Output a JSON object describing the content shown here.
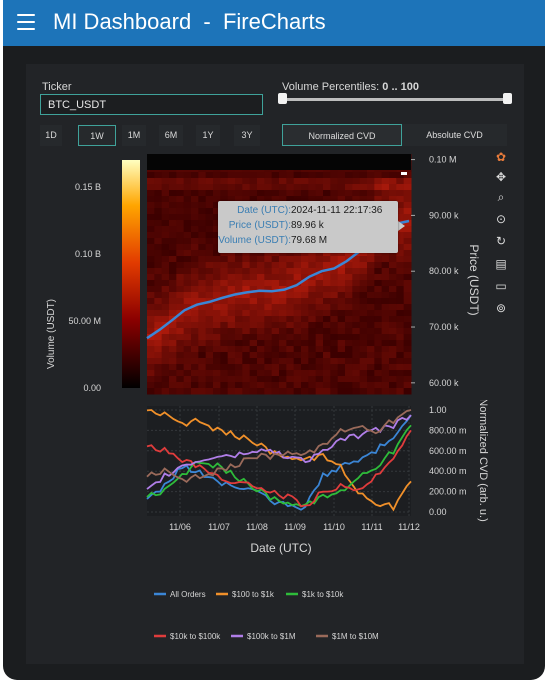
{
  "app": {
    "title": "MI Dashboard  -  FireCharts"
  },
  "controls": {
    "ticker_label": "Ticker",
    "ticker_value": "BTC_USDT",
    "percentiles_label": "Volume Percentiles:",
    "percentiles_value": "0 .. 100",
    "percentiles_range": [
      0,
      100
    ],
    "ranges": [
      "1D",
      "1W",
      "1M",
      "6M",
      "1Y",
      "3Y"
    ],
    "selected_range": "1W",
    "cvd_modes": [
      "Normalized CVD",
      "Absolute CVD"
    ],
    "selected_cvd_mode": "Normalized CVD"
  },
  "toolbar": {
    "icons": [
      "logo-icon",
      "pan-icon",
      "zoom-icon",
      "lasso-icon",
      "reset-icon",
      "save-icon",
      "comment-icon",
      "settings-icon"
    ]
  },
  "tooltip": {
    "date_label": "Date (UTC):",
    "date_value": "2024-11-11 22:17:36",
    "price_label": "Price (USDT):",
    "price_value": "89.96 k",
    "volume_label": "Volume (USDT):",
    "volume_value": "79.68 M"
  },
  "colors": {
    "topbar": "#1d74b9",
    "accent": "#3fa29a",
    "price_line": "#3b86d6"
  },
  "chart_data": [
    {
      "type": "heatmap",
      "title": "",
      "colorbar": {
        "label": "Volume (USDT)",
        "ticks": [
          "0.00",
          "50.00 M",
          "0.10 B",
          "0.15 B"
        ],
        "range": [
          0,
          170000000
        ]
      },
      "y_right": {
        "label": "Price (USDT)",
        "ticks": [
          "60.00 k",
          "70.00 k",
          "80.00 k",
          "90.00 k",
          "0.10 M"
        ],
        "range": [
          58000,
          101000
        ]
      },
      "price_series": {
        "name": "Price",
        "x": [
          "2024-11-05 12:00",
          "2024-11-06 00:00",
          "2024-11-06 06:00",
          "2024-11-06 12:00",
          "2024-11-06 18:00",
          "2024-11-07 00:00",
          "2024-11-07 12:00",
          "2024-11-08 00:00",
          "2024-11-08 12:00",
          "2024-11-09 00:00",
          "2024-11-09 12:00",
          "2024-11-10 00:00",
          "2024-11-10 06:00",
          "2024-11-10 12:00",
          "2024-11-10 18:00",
          "2024-11-11 00:00",
          "2024-11-11 06:00",
          "2024-11-11 12:00",
          "2024-11-11 18:00",
          "2024-11-11 22:17",
          "2024-11-12 00:00",
          "2024-11-12 03:00"
        ],
        "values": [
          68000,
          69500,
          71200,
          73000,
          74000,
          74500,
          75200,
          75800,
          76200,
          76500,
          76400,
          76700,
          77500,
          79000,
          80000,
          80500,
          81800,
          83500,
          86500,
          89960,
          88500,
          89000
        ]
      }
    },
    {
      "type": "line",
      "title": "",
      "xlabel": "Date (UTC)",
      "ylabel": "Normalized CVD (arb. u.)",
      "x_ticks": [
        "11/06",
        "11/07",
        "11/08",
        "11/09",
        "11/10",
        "11/11",
        "11/12"
      ],
      "y_ticks": [
        "0.00",
        "200.00 m",
        "400.00 m",
        "600.00 m",
        "800.00 m",
        "1.00"
      ],
      "ylim": [
        0,
        1
      ],
      "x": [
        "11/05 12h",
        "11/06 00h",
        "11/06 12h",
        "11/07 00h",
        "11/07 12h",
        "11/08 00h",
        "11/08 12h",
        "11/09 00h",
        "11/09 12h",
        "11/10 00h",
        "11/10 12h",
        "11/11 00h",
        "11/11 06h",
        "11/11 12h",
        "11/11 18h",
        "11/12 00h"
      ],
      "series": [
        {
          "name": "All Orders",
          "color": "#3b86d6",
          "values": [
            0.1,
            0.25,
            0.45,
            0.38,
            0.3,
            0.25,
            0.2,
            0.12,
            0.05,
            0.05,
            0.35,
            0.45,
            0.5,
            0.6,
            0.75,
            0.95
          ]
        },
        {
          "name": "$100 to $1k",
          "color": "#f0902a",
          "values": [
            1.0,
            0.95,
            0.85,
            0.9,
            0.8,
            0.75,
            0.7,
            0.6,
            0.55,
            0.5,
            0.55,
            0.45,
            0.2,
            0.1,
            0.05,
            0.3
          ]
        },
        {
          "name": "$1k to $10k",
          "color": "#2ebc3a",
          "values": [
            0.15,
            0.2,
            0.35,
            0.5,
            0.45,
            0.35,
            0.25,
            0.15,
            0.1,
            0.05,
            0.15,
            0.2,
            0.35,
            0.45,
            0.6,
            0.85
          ]
        },
        {
          "name": "$10k to $100k",
          "color": "#e03c3c",
          "values": [
            0.65,
            0.6,
            0.5,
            0.45,
            0.35,
            0.3,
            0.25,
            0.2,
            0.15,
            0.05,
            0.2,
            0.25,
            0.2,
            0.35,
            0.55,
            0.8
          ]
        },
        {
          "name": "$100k to $1M",
          "color": "#b07ee8",
          "values": [
            0.2,
            0.35,
            0.45,
            0.5,
            0.55,
            0.55,
            0.6,
            0.6,
            0.55,
            0.5,
            0.6,
            0.7,
            0.75,
            0.8,
            0.85,
            0.95
          ]
        },
        {
          "name": "$1M to $10M",
          "color": "#9a6a5a",
          "values": [
            0.35,
            0.4,
            0.3,
            0.35,
            0.4,
            0.45,
            0.55,
            0.55,
            0.6,
            0.55,
            0.65,
            0.8,
            0.85,
            0.8,
            0.9,
            1.0
          ]
        }
      ],
      "legend": {
        "placement": "bottom"
      }
    }
  ]
}
